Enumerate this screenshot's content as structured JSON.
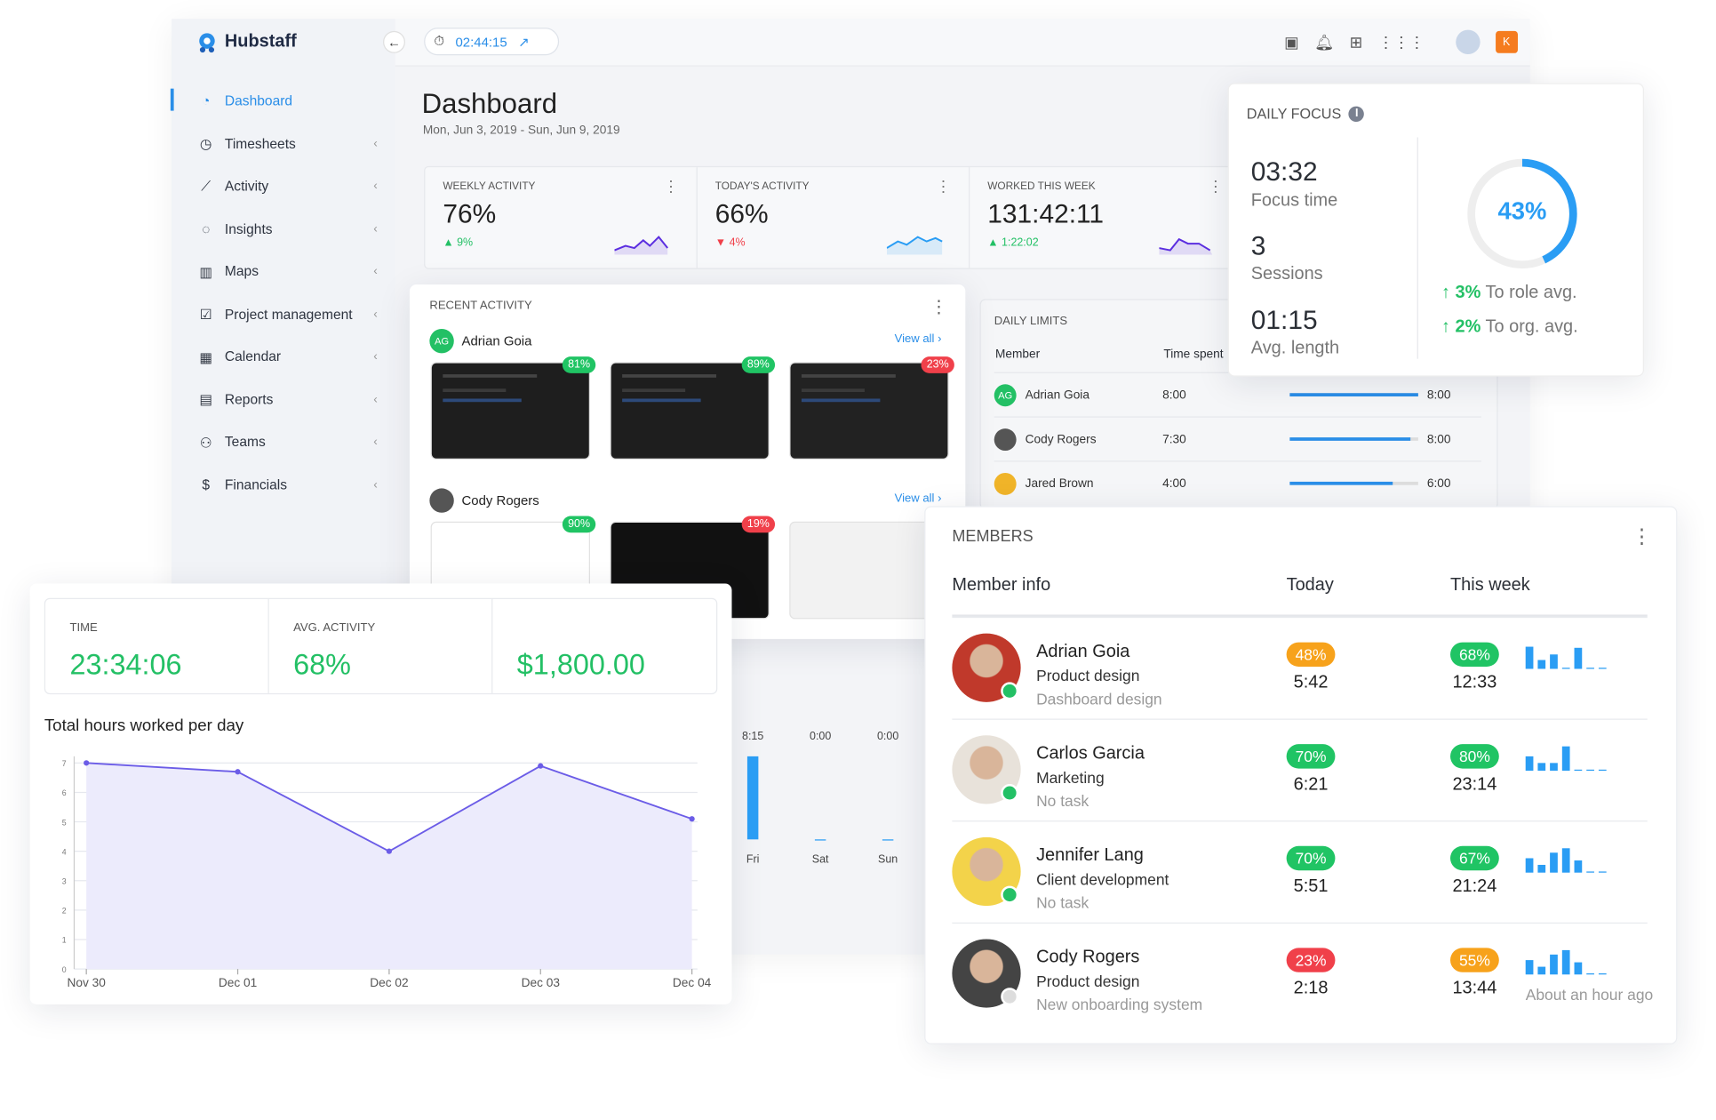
{
  "app": {
    "name": "Hubstaff",
    "timer": "02:44:15",
    "user_initial": "K",
    "accent": "#2a8ee8"
  },
  "sidebar": {
    "items": [
      {
        "label": "Dashboard",
        "icon": "dashboard-icon",
        "active": true
      },
      {
        "label": "Timesheets",
        "icon": "clock-icon"
      },
      {
        "label": "Activity",
        "icon": "chart-icon"
      },
      {
        "label": "Insights",
        "icon": "bulb-icon"
      },
      {
        "label": "Maps",
        "icon": "map-icon"
      },
      {
        "label": "Project management",
        "icon": "checkbox-icon"
      },
      {
        "label": "Calendar",
        "icon": "calendar-icon"
      },
      {
        "label": "Reports",
        "icon": "report-icon"
      },
      {
        "label": "Teams",
        "icon": "teams-icon"
      },
      {
        "label": "Financials",
        "icon": "dollar-icon"
      }
    ]
  },
  "header": {
    "title": "Dashboard",
    "date_range": "Mon, Jun 3, 2019 - Sun, Jun 9, 2019"
  },
  "stats": [
    {
      "label": "Weekly activity",
      "value": "76%",
      "change": "9%",
      "dir": "up"
    },
    {
      "label": "Today's activity",
      "value": "66%",
      "change": "4%",
      "dir": "down"
    },
    {
      "label": "Worked this week",
      "value": "131:42:11",
      "change": "1:22:02",
      "dir": "up"
    }
  ],
  "recent": {
    "title": "Recent activity",
    "view_all": "View all",
    "people": [
      {
        "name": "Adrian Goia",
        "initials": "AG",
        "shots": [
          "81%",
          "89%",
          "23%"
        ]
      },
      {
        "name": "Cody Rogers",
        "initials": "",
        "shots": [
          "90%",
          "19%",
          ""
        ]
      }
    ]
  },
  "limits": {
    "title": "Daily limits",
    "col_member": "Member",
    "col_time": "Time spent",
    "rows": [
      {
        "name": "Adrian Goia",
        "initials": "AG",
        "spent": "8:00",
        "limit": "8:00",
        "progress": 1.0
      },
      {
        "name": "Cody Rogers",
        "spent": "7:30",
        "limit": "8:00",
        "progress": 0.94
      },
      {
        "name": "Jared Brown",
        "spent": "4:00",
        "limit": "6:00",
        "progress": 0.8
      }
    ]
  },
  "focus": {
    "title": "Daily focus",
    "focus_time": "03:32",
    "focus_label": "Focus time",
    "sessions": "3",
    "sessions_label": "Sessions",
    "avg": "01:15",
    "avg_label": "Avg. length",
    "percent": "43%",
    "percent_value": 43,
    "role_change": "3%",
    "role_label": "To role avg.",
    "org_change": "2%",
    "org_label": "To org. avg."
  },
  "summary": {
    "time_label": "Time",
    "time": "23:34:06",
    "activity_label": "Avg. activity",
    "activity": "68%",
    "earnings": "$1,800.00"
  },
  "weekbars": {
    "values": [
      "8:15",
      "0:00",
      "0:00"
    ],
    "days": [
      "Fri",
      "Sat",
      "Sun"
    ]
  },
  "chart_data": {
    "type": "area",
    "title": "Total hours worked per day",
    "categories": [
      "Nov 30",
      "Dec 01",
      "Dec 02",
      "Dec 03",
      "Dec 04"
    ],
    "values": [
      7,
      6.7,
      4,
      6.9,
      5.1
    ],
    "ylim": [
      0,
      7
    ],
    "yticks": [
      0,
      1,
      2,
      3,
      4,
      5,
      6,
      7
    ],
    "grid": true,
    "color": "#6b5ce7"
  },
  "members": {
    "title": "Members",
    "cols": [
      "Member info",
      "Today",
      "This week"
    ],
    "rows": [
      {
        "name": "Adrian Goia",
        "role": "Product design",
        "task": "Dashboard design",
        "today_pct": "48%",
        "today_color": "o",
        "today": "5:42",
        "week_pct": "68%",
        "week_color": "g",
        "week": "12:33",
        "online": true,
        "bars": [
          0.9,
          0.35,
          0.6,
          0.05,
          0.85,
          0.05,
          0.05
        ],
        "note": ""
      },
      {
        "name": "Carlos Garcia",
        "role": "Marketing",
        "task": "No task",
        "today_pct": "70%",
        "today_color": "g",
        "today": "6:21",
        "week_pct": "80%",
        "week_color": "g",
        "week": "23:14",
        "online": true,
        "bars": [
          0.6,
          0.3,
          0.3,
          1,
          0.05,
          0.05,
          0.05
        ],
        "note": ""
      },
      {
        "name": "Jennifer Lang",
        "role": "Client development",
        "task": "No task",
        "today_pct": "70%",
        "today_color": "g",
        "today": "5:51",
        "week_pct": "67%",
        "week_color": "g",
        "week": "21:24",
        "online": true,
        "bars": [
          0.6,
          0.3,
          0.8,
          1,
          0.5,
          0.05,
          0.05
        ],
        "note": ""
      },
      {
        "name": "Cody Rogers",
        "role": "Product design",
        "task": "New onboarding system",
        "today_pct": "23%",
        "today_color": "r",
        "today": "2:18",
        "week_pct": "55%",
        "week_color": "o",
        "week": "13:44",
        "online": false,
        "bars": [
          0.6,
          0.3,
          0.8,
          1,
          0.5,
          0.05,
          0.05
        ],
        "note": "About an hour ago"
      }
    ]
  }
}
